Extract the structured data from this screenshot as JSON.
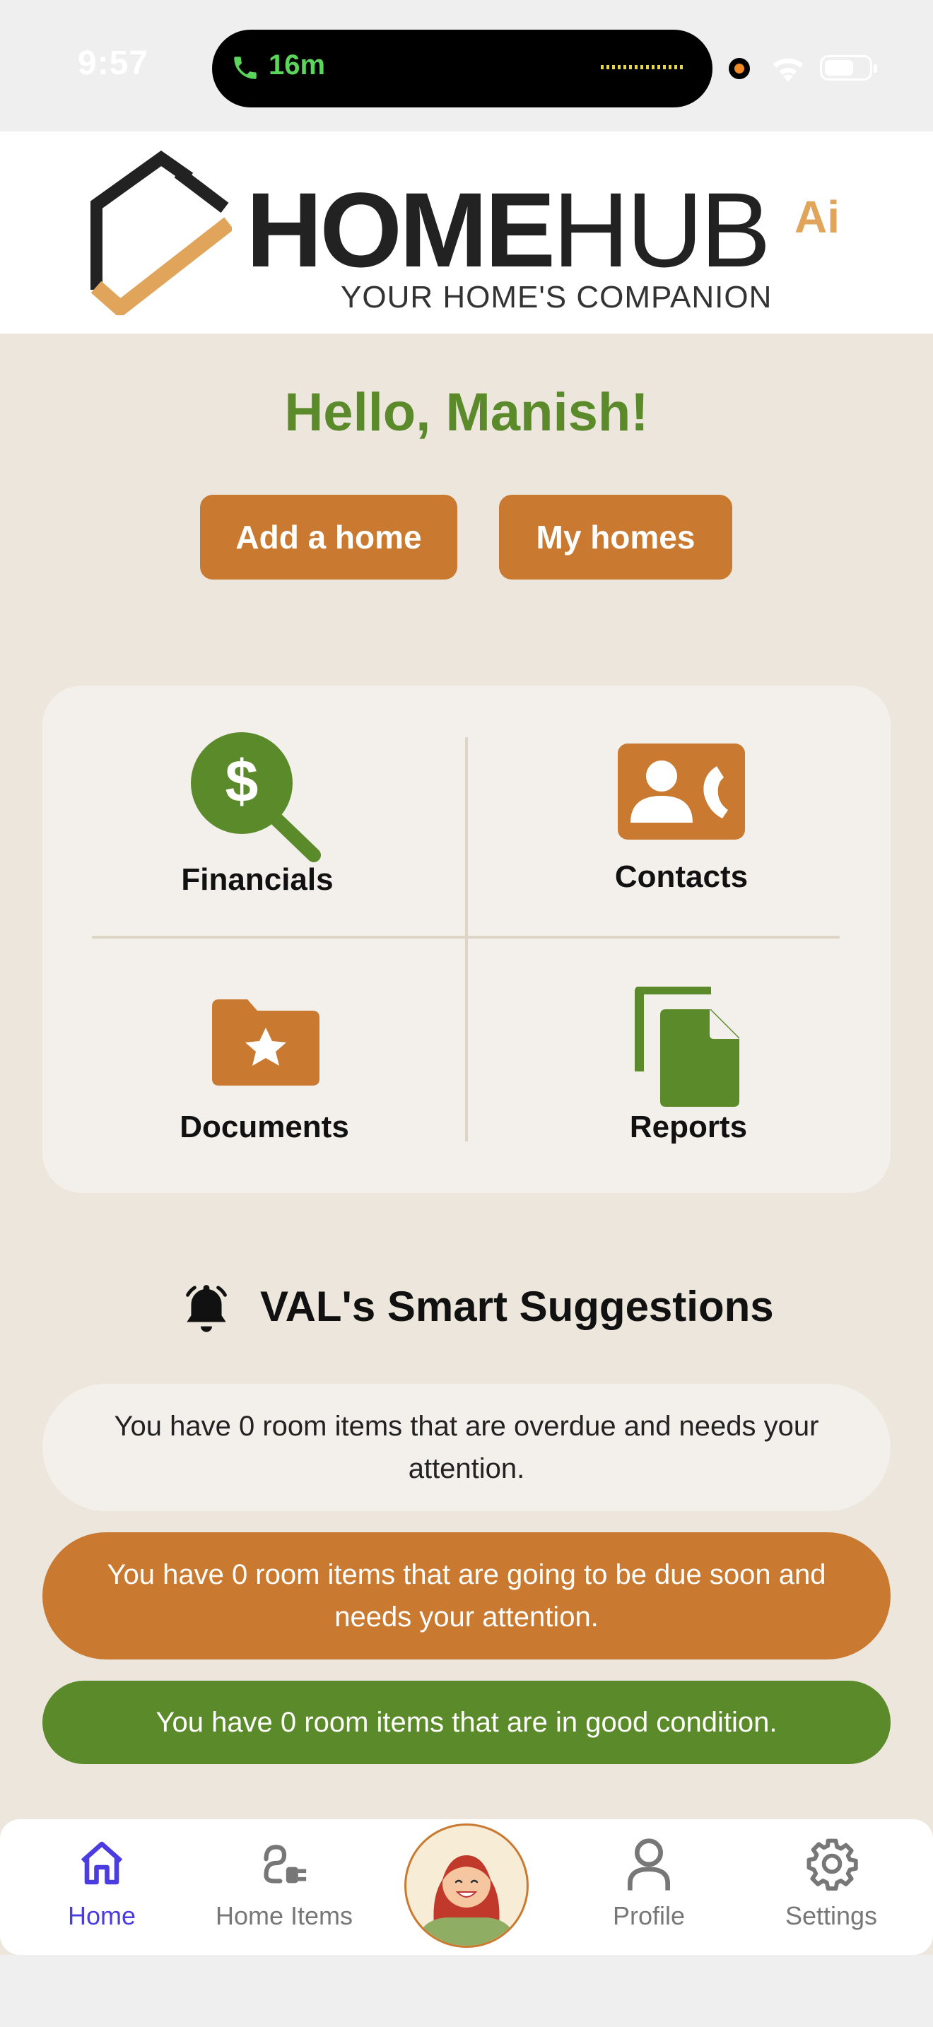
{
  "status_bar": {
    "time": "9:57",
    "call_duration": "16m"
  },
  "header": {
    "logo_home": "HOME",
    "logo_hub": "HUB",
    "logo_ai": "Ai",
    "tagline": "YOUR HOME'S COMPANION"
  },
  "greeting": "Hello, Manish!",
  "actions": {
    "add_home": "Add a home",
    "my_homes": "My homes"
  },
  "tiles": {
    "financials": "Financials",
    "contacts": "Contacts",
    "documents": "Documents",
    "reports": "Reports"
  },
  "suggestions": {
    "title": "VAL's Smart Suggestions",
    "items": [
      "You have 0 room items that are overdue and needs your attention.",
      "You have 0 room items that are going to be due soon and needs your attention.",
      "You have 0 room items that are in good condition."
    ]
  },
  "nav": {
    "home": "Home",
    "home_items": "Home Items",
    "profile": "Profile",
    "settings": "Settings"
  },
  "colors": {
    "accent_orange": "#c97a30",
    "accent_green": "#5b8a2a",
    "nav_active": "#4a3ce0",
    "background": "#ece6dc"
  }
}
